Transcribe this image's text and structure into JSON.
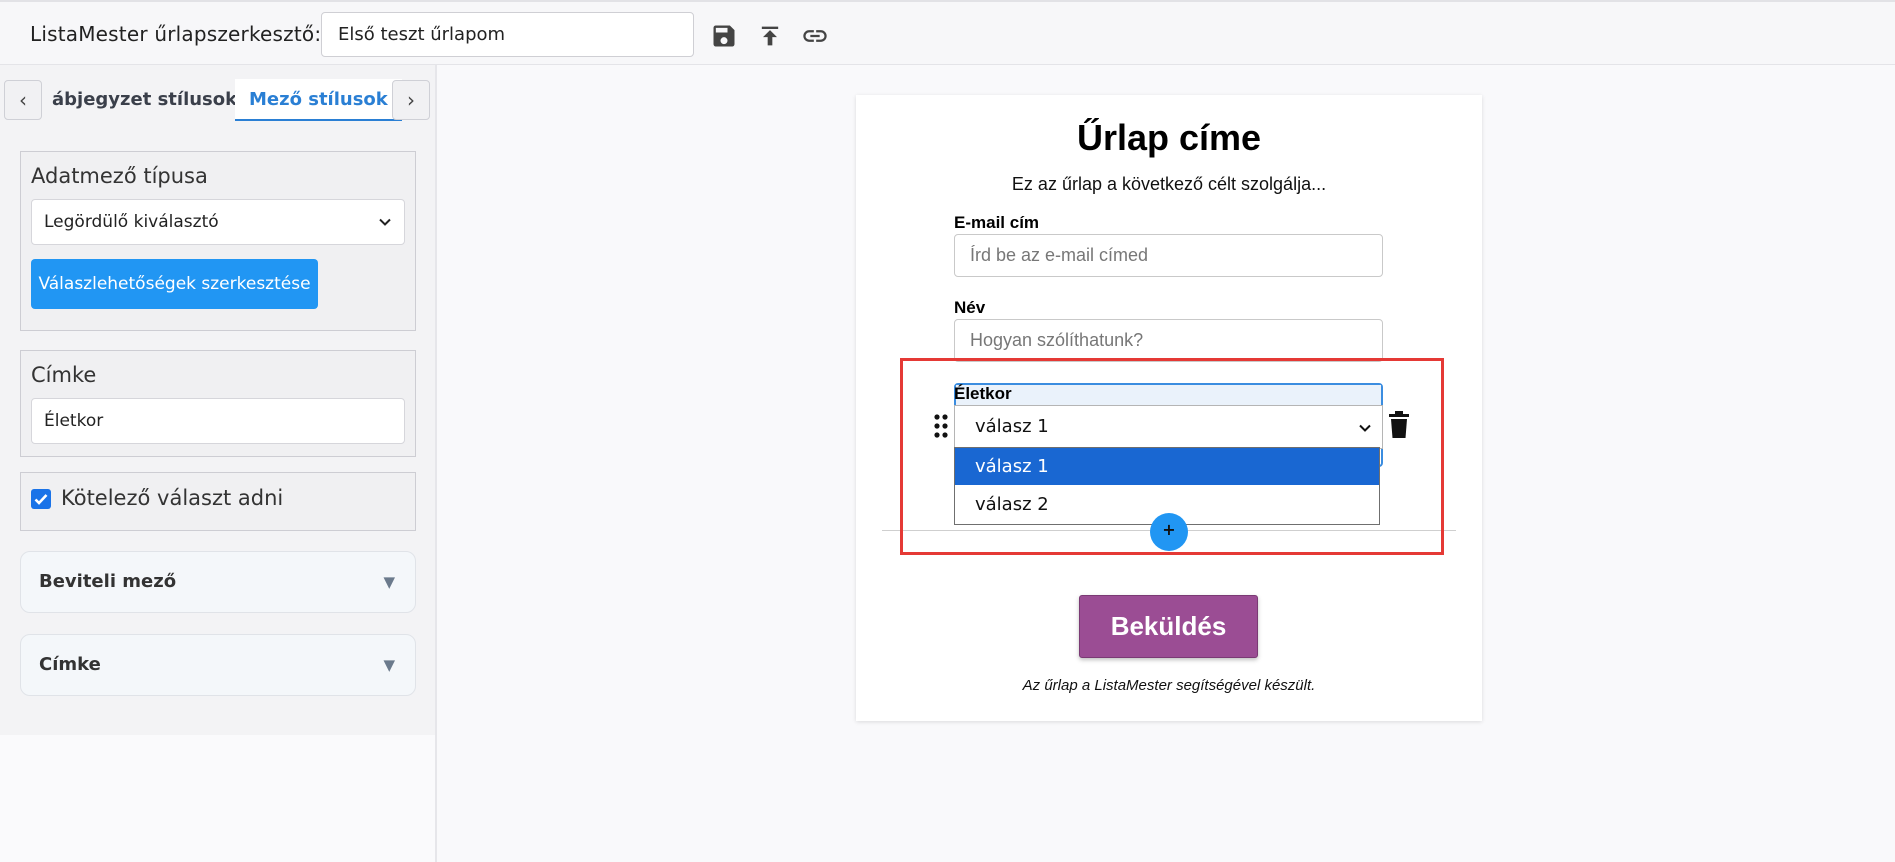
{
  "header": {
    "app_title": "ListaMester űrlapszerkesztő:",
    "form_name_value": "Első teszt űrlapom",
    "icons": [
      "save-icon",
      "upload-icon",
      "link-icon"
    ]
  },
  "sidebar": {
    "tab_prev": "‹",
    "tab_next": "›",
    "tabs": [
      {
        "label": "ábjegyzet stílusok"
      },
      {
        "label": "Mező stílusok"
      }
    ],
    "field_type": {
      "label": "Adatmező típusa",
      "selected": "Legördülő kiválasztó",
      "edit_button": "Válaszlehetőségek szerkesztése"
    },
    "label_section": {
      "label": "Címke",
      "value": "Életkor"
    },
    "required": {
      "label": "Kötelező választ adni",
      "checked": true
    },
    "collapsibles": [
      {
        "label": "Beviteli mező",
        "arrow": "▼"
      },
      {
        "label": "Címke",
        "arrow": "▼"
      }
    ]
  },
  "form": {
    "title": "Űrlap címe",
    "description": "Ez az űrlap a következő célt szolgálja...",
    "fields": [
      {
        "label": "E-mail cím",
        "placeholder": "Írd be az e-mail címed"
      },
      {
        "label": "Név",
        "placeholder": "Hogyan szólíthatunk?"
      }
    ],
    "select_field": {
      "label": "Életkor",
      "selected": "válasz 1",
      "options": [
        "válasz 1",
        "válasz 2"
      ]
    },
    "add_button": "+",
    "submit": "Beküldés",
    "footer": "Az űrlap a ListaMester segítségével készült."
  },
  "colors": {
    "accent_blue": "#2196f3",
    "submit_purple": "#9b4d94",
    "highlight_red": "#e53935",
    "dropdown_selected": "#1967d2"
  }
}
